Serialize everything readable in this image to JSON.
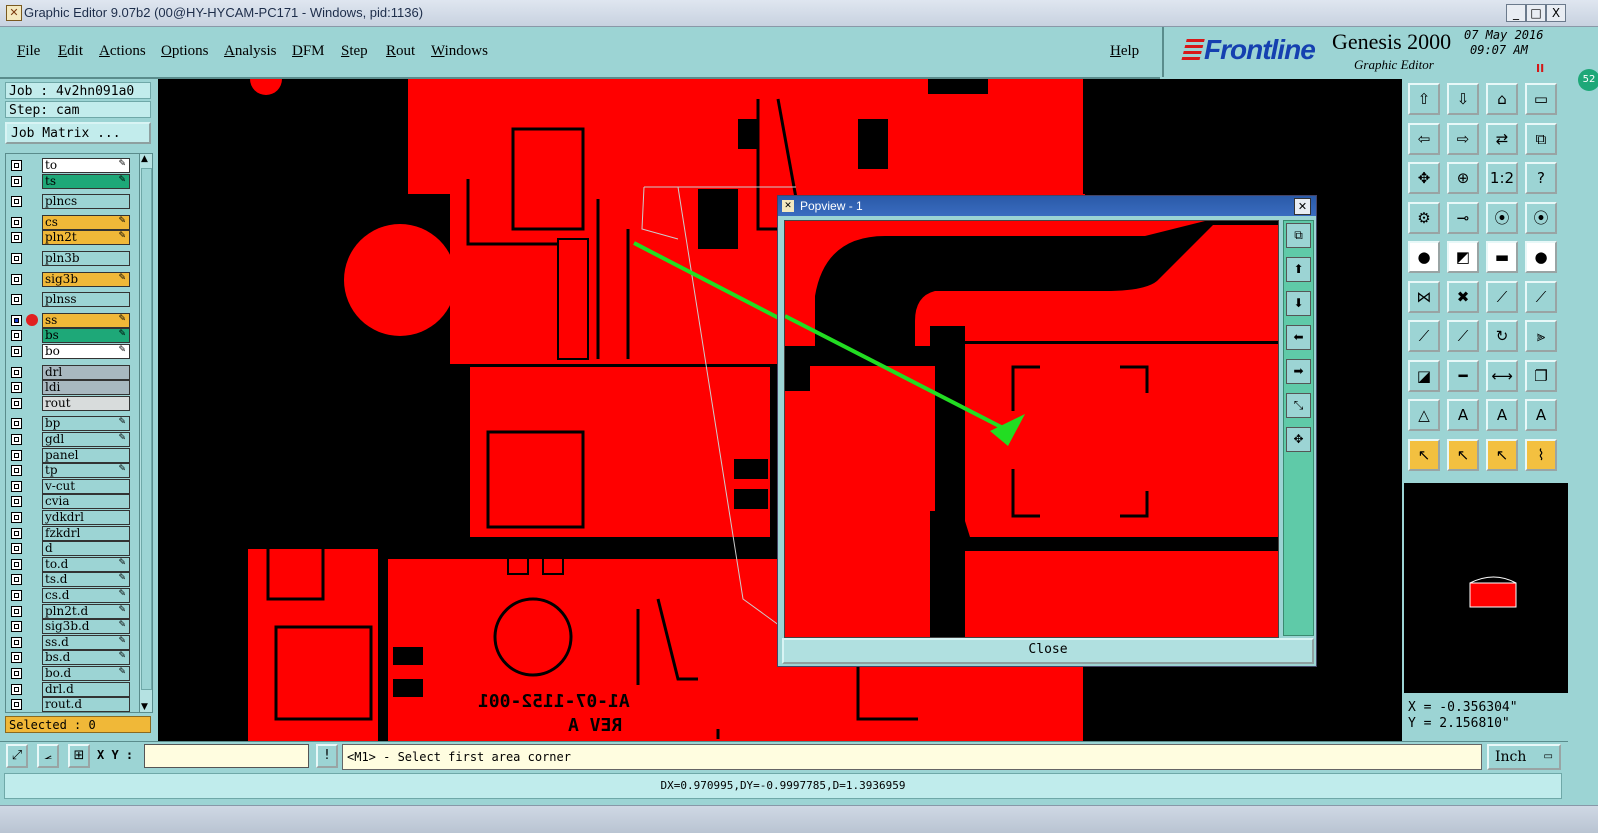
{
  "window": {
    "title": "Graphic Editor 9.07b2 (00@HY-HYCAM-PC171 - Windows, pid:1136)",
    "minimize": "_",
    "maximize": "□",
    "close": "X"
  },
  "menu": {
    "items": [
      "File",
      "Edit",
      "Actions",
      "Options",
      "Analysis",
      "DFM",
      "Step",
      "Rout",
      "Windows"
    ],
    "help": "Help"
  },
  "brand": {
    "logo": "Frontline",
    "product": "Genesis 2000",
    "subtitle": "Graphic Editor",
    "date": "07 May 2016",
    "time": "09:07 AM",
    "pause": "II"
  },
  "job": {
    "job_label": "Job : 4v2hn091a0",
    "step_label": "Step: cam",
    "matrix_button": "Job Matrix ..."
  },
  "layers": [
    {
      "name": "to",
      "color": "#ffffff",
      "edit": true
    },
    {
      "name": "ts",
      "color": "#1ea878",
      "edit": true
    },
    {
      "name": "plncs",
      "color": "#9cd4d4",
      "edit": false
    },
    {
      "name": "cs",
      "color": "#f0b838",
      "edit": true
    },
    {
      "name": "pln2t",
      "color": "#f0b838",
      "edit": true
    },
    {
      "name": "pln3b",
      "color": "#9cd4d4",
      "edit": false
    },
    {
      "name": "sig3b",
      "color": "#f0b838",
      "edit": true
    },
    {
      "name": "plnss",
      "color": "#9cd4d4",
      "edit": false
    },
    {
      "name": "ss",
      "color": "#f0b838",
      "edit": true,
      "active": true
    },
    {
      "name": "bs",
      "color": "#1ea878",
      "edit": true
    },
    {
      "name": "bo",
      "color": "#ffffff",
      "edit": true
    },
    {
      "name": "drl",
      "color": "#a8b8c0",
      "edit": false
    },
    {
      "name": "ldi",
      "color": "#a8b8c0",
      "edit": false
    },
    {
      "name": "rout",
      "color": "#d8dcdc",
      "edit": false
    },
    {
      "name": "bp",
      "color": "#9cd4d4",
      "edit": true
    },
    {
      "name": "gdl",
      "color": "#9cd4d4",
      "edit": true
    },
    {
      "name": "panel",
      "color": "#9cd4d4",
      "edit": false
    },
    {
      "name": "tp",
      "color": "#9cd4d4",
      "edit": true
    },
    {
      "name": "v-cut",
      "color": "#9cd4d4",
      "edit": false
    },
    {
      "name": "cvia",
      "color": "#9cd4d4",
      "edit": false
    },
    {
      "name": "ydkdrl",
      "color": "#9cd4d4",
      "edit": false
    },
    {
      "name": "fzkdrl",
      "color": "#9cd4d4",
      "edit": false
    },
    {
      "name": "d",
      "color": "#9cd4d4",
      "edit": false
    },
    {
      "name": "to.d",
      "color": "#9cd4d4",
      "edit": true
    },
    {
      "name": "ts.d",
      "color": "#9cd4d4",
      "edit": true
    },
    {
      "name": "cs.d",
      "color": "#9cd4d4",
      "edit": true
    },
    {
      "name": "pln2t.d",
      "color": "#9cd4d4",
      "edit": true
    },
    {
      "name": "sig3b.d",
      "color": "#9cd4d4",
      "edit": true
    },
    {
      "name": "ss.d",
      "color": "#9cd4d4",
      "edit": true
    },
    {
      "name": "bs.d",
      "color": "#9cd4d4",
      "edit": true
    },
    {
      "name": "bo.d",
      "color": "#9cd4d4",
      "edit": true
    },
    {
      "name": "drl.d",
      "color": "#9cd4d4",
      "edit": false
    },
    {
      "name": "rout.d",
      "color": "#9cd4d4",
      "edit": false
    }
  ],
  "selected": "Selected : 0",
  "board_text": {
    "line1": "A1-07-1152-001",
    "line2": "REV A"
  },
  "popview": {
    "title": "Popview - 1",
    "close_label": "Close"
  },
  "coords": {
    "x": "X = -0.356304\"",
    "y": "Y = 2.156810\""
  },
  "bottom": {
    "xy_label": "X Y :",
    "xy_value": "",
    "bang": "!",
    "prompt": "<M1> - Select first area corner",
    "units": "Inch"
  },
  "status": "DX=0.970995,DY=-0.9997785,D=1.3936959",
  "side_badge": "52",
  "colors": {
    "accent": "#9cd4d4",
    "board": "#ff0000",
    "background": "#000000",
    "selection_arrow": "#22dd22",
    "highlight": "#f0b838"
  }
}
